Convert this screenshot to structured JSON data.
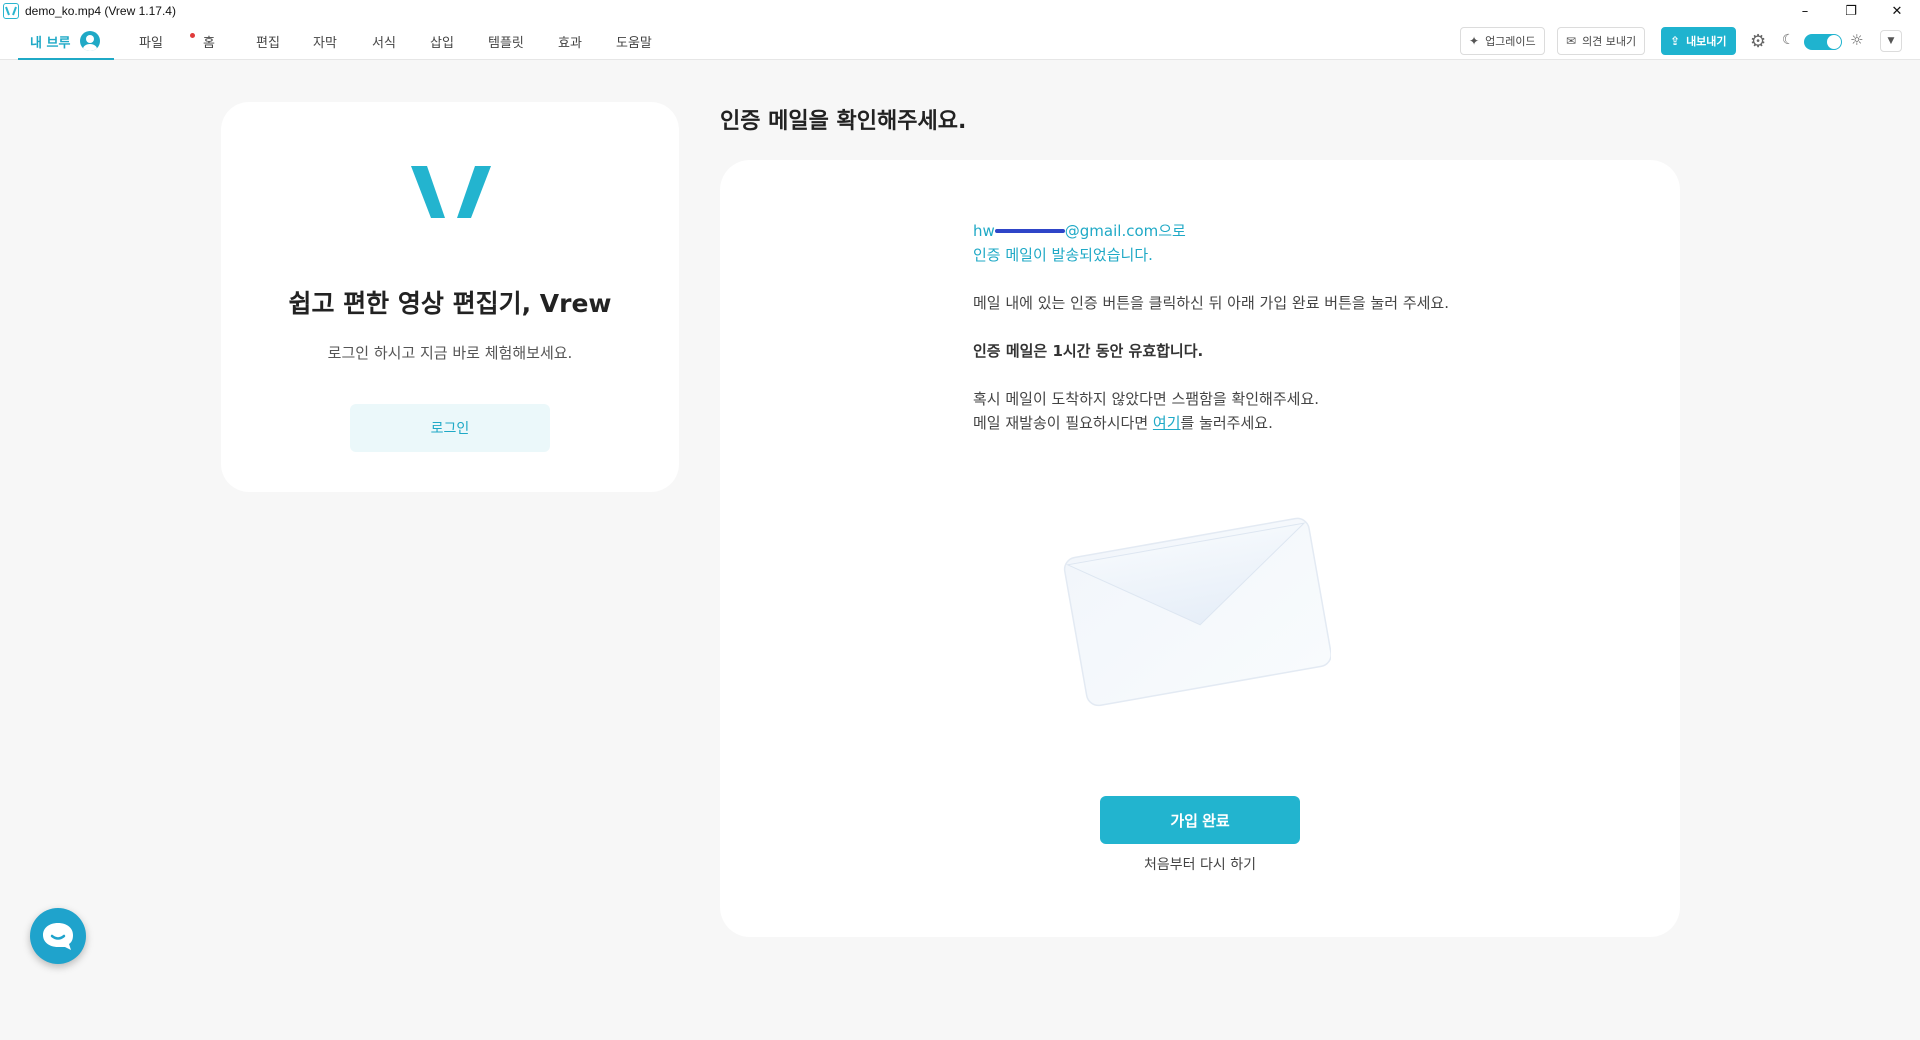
{
  "window": {
    "title": "demo_ko.mp4 (Vrew 1.17.4)",
    "controls": [
      "–",
      "❐",
      "✕"
    ]
  },
  "menu": {
    "my_vrew": "내 브루",
    "items": [
      "파일",
      "홈",
      "편집",
      "자막",
      "서식",
      "삽입",
      "템플릿",
      "효과",
      "도움말"
    ]
  },
  "toolbar": {
    "upgrade": "업그레이드",
    "feedback": "의견 보내기",
    "export": "내보내기"
  },
  "left_card": {
    "title": "쉽고 편한 영상 편집기, Vrew",
    "subtitle": "로그인 하시고 지금 바로 체험해보세요.",
    "login_label": "로그인"
  },
  "main": {
    "heading": "인증 메일을 확인해주세요.",
    "email_prefix": "hw",
    "email_suffix": "@gmail.com으로",
    "sent_message": "인증 메일이 발송되었습니다.",
    "instruction": "메일 내에 있는 인증 버튼을 클릭하신 뒤 아래 가입 완료 버튼을 눌러 주세요.",
    "validity": "인증 메일은 1시간 동안 유효합니다.",
    "spam_notice": "혹시 메일이 도착하지 않았다면 스팸함을 확인해주세요.",
    "resend_prefix": "메일 재발송이 필요하시다면 ",
    "resend_link": "여기",
    "resend_suffix": "를 눌러주세요.",
    "complete_label": "가입 완료",
    "restart_label": "처음부터 다시 하기"
  },
  "colors": {
    "accent": "#1fb3cf",
    "redaction": "#2f45c8",
    "notification_dot": "#e03a3a"
  }
}
